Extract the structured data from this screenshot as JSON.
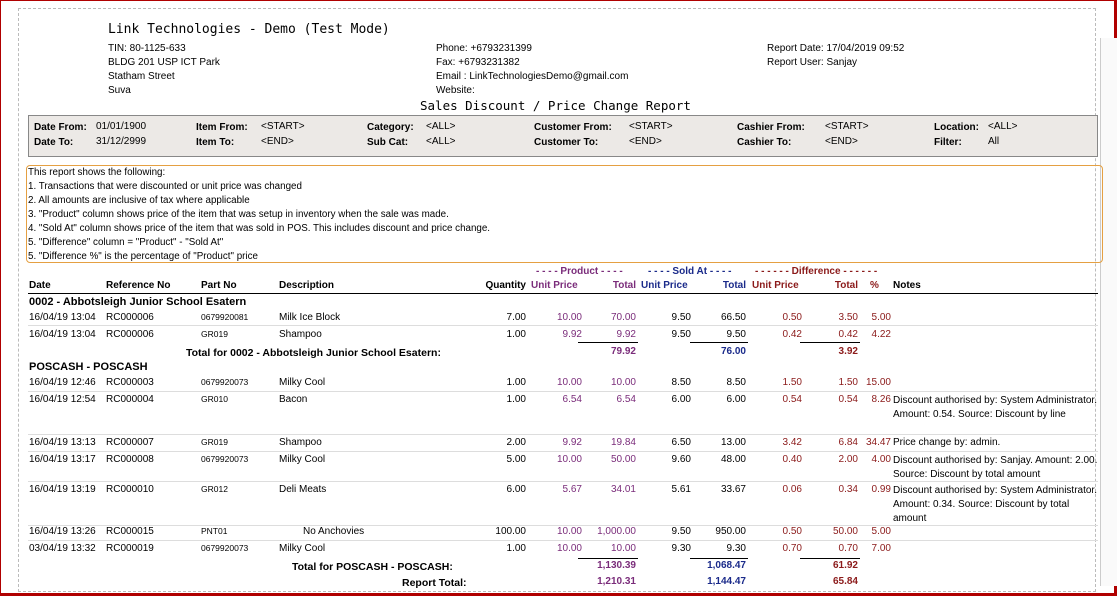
{
  "company": {
    "name": "Link Technologies - Demo (Test Mode)"
  },
  "address": {
    "tin": "TIN: 80-1125-633",
    "line1": "BLDG 201 USP ICT Park",
    "line2": "Statham Street",
    "line3": "Suva"
  },
  "contact": {
    "phone": "Phone: +6793231399",
    "fax": "Fax: +6793231382",
    "email": "Email : LinkTechnologiesDemo@gmail.com",
    "website": "Website:"
  },
  "meta": {
    "date": "Report Date: 17/04/2019 09:52",
    "user": "Report User: Sanjay"
  },
  "title": "Sales Discount / Price Change Report",
  "filters": {
    "date_from_l": "Date From:",
    "date_from_v": "01/01/1900",
    "date_to_l": "Date To:",
    "date_to_v": "31/12/2999",
    "item_from_l": "Item From:",
    "item_from_v": "<START>",
    "item_to_l": "Item To:",
    "item_to_v": "<END>",
    "category_l": "Category:",
    "category_v": "<ALL>",
    "subcat_l": "Sub Cat:",
    "subcat_v": "<ALL>",
    "cust_from_l": "Customer From:",
    "cust_from_v": "<START>",
    "cust_to_l": "Customer To:",
    "cust_to_v": "<END>",
    "cash_from_l": "Cashier From:",
    "cash_from_v": "<START>",
    "cash_to_l": "Cashier To:",
    "cash_to_v": "<END>",
    "location_l": "Location:",
    "location_v": "<ALL>",
    "filter_l": "Filter:",
    "filter_v": "All"
  },
  "notes": [
    "This report shows the following:",
    "1. Transactions that were discounted or unit price was changed",
    "2. All amounts are inclusive of tax where applicable",
    "3. \"Product\" column shows price of the item that was setup in inventory when the sale was made.",
    "4. \"Sold At\" column shows price of the item that was sold in POS. This includes discount and price change.",
    "5. \"Difference\" column = \"Product\" - \"Sold At\"",
    "5. \"Difference %\" is the percentage of  \"Product\" price"
  ],
  "group_headers": {
    "product": "- - - - Product - - - -",
    "sold_at": "- - - - Sold At - - - -",
    "difference": "- - - - - - Difference - - - - - -"
  },
  "columns": {
    "date": "Date",
    "ref": "Reference No",
    "part": "Part No",
    "desc": "Description",
    "qty": "Quantity",
    "p_unit": "Unit Price",
    "p_total": "Total",
    "s_unit": "Unit Price",
    "s_total": "Total",
    "d_unit": "Unit Price",
    "d_total": "Total",
    "pct": "%",
    "notes": "Notes"
  },
  "groups": [
    {
      "name": "0002 - Abbotsleigh Junior School Esatern",
      "rows": [
        {
          "date": "16/04/19  13:04",
          "ref": "RC000006",
          "part": "0679920081",
          "desc": "Milk Ice Block",
          "qty": "7.00",
          "pu": "10.00",
          "pt": "70.00",
          "su": "9.50",
          "st": "66.50",
          "du": "0.50",
          "dt": "3.50",
          "pct": "5.00",
          "note": ""
        },
        {
          "date": "16/04/19  13:04",
          "ref": "RC000006",
          "part": "GR019",
          "desc": "Shampoo",
          "qty": "1.00",
          "pu": "9.92",
          "pt": "9.92",
          "su": "9.50",
          "st": "9.50",
          "du": "0.42",
          "dt": "0.42",
          "pct": "4.22",
          "note": ""
        }
      ],
      "total_label": "Total for 0002 - Abbotsleigh Junior School Esatern:",
      "total_p": "79.92",
      "total_s": "76.00",
      "total_d": "3.92"
    },
    {
      "name": "POSCASH - POSCASH",
      "rows": [
        {
          "date": "16/04/19  12:46",
          "ref": "RC000003",
          "part": "0679920073",
          "desc": "Milky Cool",
          "qty": "1.00",
          "pu": "10.00",
          "pt": "10.00",
          "su": "8.50",
          "st": "8.50",
          "du": "1.50",
          "dt": "1.50",
          "pct": "15.00",
          "note": ""
        },
        {
          "date": "16/04/19  12:54",
          "ref": "RC000004",
          "part": "GR010",
          "desc": "Bacon",
          "qty": "1.00",
          "pu": "6.54",
          "pt": "6.54",
          "su": "6.00",
          "st": "6.00",
          "du": "0.54",
          "dt": "0.54",
          "pct": "8.26",
          "note": "Discount authorised by: System Administrator. Amount: 0.54. Source: Discount by line"
        },
        {
          "date": "16/04/19  13:13",
          "ref": "RC000007",
          "part": "GR019",
          "desc": "Shampoo",
          "qty": "2.00",
          "pu": "9.92",
          "pt": "19.84",
          "su": "6.50",
          "st": "13.00",
          "du": "3.42",
          "dt": "6.84",
          "pct": "34.47",
          "note": "Price change by: admin."
        },
        {
          "date": "16/04/19  13:17",
          "ref": "RC000008",
          "part": "0679920073",
          "desc": "Milky Cool",
          "qty": "5.00",
          "pu": "10.00",
          "pt": "50.00",
          "su": "9.60",
          "st": "48.00",
          "du": "0.40",
          "dt": "2.00",
          "pct": "4.00",
          "note": "Discount authorised by: Sanjay. Amount: 2.00. Source: Discount by total amount"
        },
        {
          "date": "16/04/19  13:19",
          "ref": "RC000010",
          "part": "GR012",
          "desc": "Deli Meats",
          "qty": "6.00",
          "pu": "5.67",
          "pt": "34.01",
          "su": "5.61",
          "st": "33.67",
          "du": "0.06",
          "dt": "0.34",
          "pct": "0.99",
          "note": "Discount authorised by: System Administrator. Amount: 0.34. Source: Discount by total amount"
        },
        {
          "date": "16/04/19  13:26",
          "ref": "RC000015",
          "part": "PNT01",
          "desc": "No Anchovies",
          "qty": "100.00",
          "pu": "10.00",
          "pt": "1,000.00",
          "su": "9.50",
          "st": "950.00",
          "du": "0.50",
          "dt": "50.00",
          "pct": "5.00",
          "note": ""
        },
        {
          "date": "03/04/19  13:32",
          "ref": "RC000019",
          "part": "0679920073",
          "desc": "Milky Cool",
          "qty": "1.00",
          "pu": "10.00",
          "pt": "10.00",
          "su": "9.30",
          "st": "9.30",
          "du": "0.70",
          "dt": "0.70",
          "pct": "7.00",
          "note": ""
        }
      ],
      "total_label": "Total for POSCASH - POSCASH:",
      "total_p": "1,130.39",
      "total_s": "1,068.47",
      "total_d": "61.92"
    }
  ],
  "report_total": {
    "label": "Report Total:",
    "p": "1,210.31",
    "s": "1,144.47",
    "d": "65.84"
  }
}
